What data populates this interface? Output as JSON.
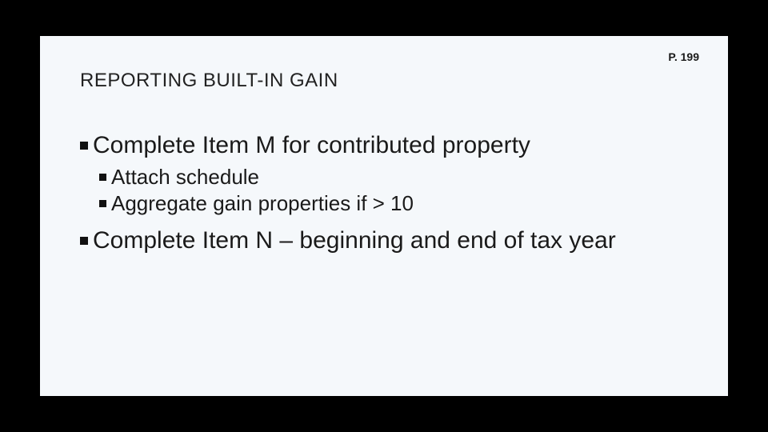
{
  "page_ref": "P. 199",
  "heading": "REPORTING BUILT-IN GAIN",
  "bullets": {
    "b1": "Complete Item M for contributed property",
    "b1a": "Attach schedule",
    "b1b": "Aggregate gain properties if > 10",
    "b2": "Complete Item N – beginning and end of tax year"
  }
}
